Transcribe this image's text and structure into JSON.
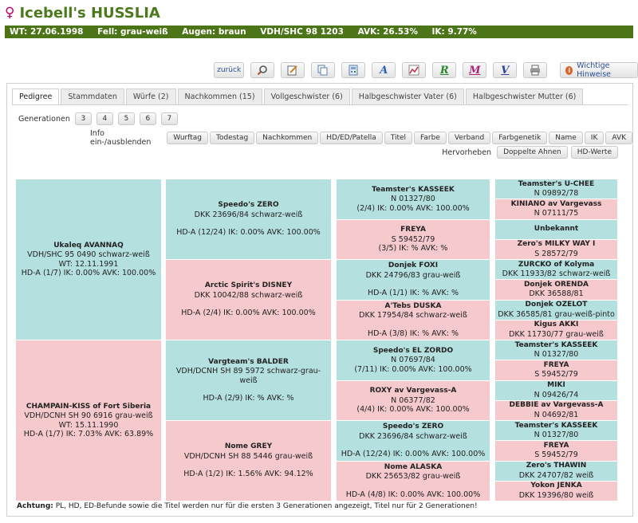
{
  "header": {
    "sex_symbol": "♀",
    "title": "Icebell's HUSSLIA",
    "info": [
      "WT: 27.06.1998",
      "Fell: grau-weiß",
      "Augen: braun",
      "VDH/SHC 98 1203",
      "AVK: 26.53%",
      "IK: 9.77%"
    ]
  },
  "toolbar": {
    "back_label": "zurück",
    "icons": [
      "magnifier-icon",
      "edit-icon",
      "copy-icon",
      "calculator-icon",
      "a-letter-icon",
      "chart-icon",
      "r-letter-icon",
      "m-letter-icon",
      "v-letter-icon",
      "print-icon"
    ],
    "icon_glyphs": [
      "",
      "",
      "",
      "",
      "A",
      "",
      "R",
      "M",
      "V",
      ""
    ],
    "icon_colors": [
      "#333",
      "#333",
      "#333",
      "#333",
      "#2a5fc0",
      "#333",
      "#2a8a2a",
      "#b0207a",
      "#2a3fa0",
      "#333"
    ],
    "hints_label": "Wichtige Hinweise"
  },
  "tabs": [
    "Pedigree",
    "Stammdaten",
    "Würfe (2)",
    "Nachkommen (15)",
    "Vollgeschwister (6)",
    "Halbgeschwister Vater (6)",
    "Halbgeschwister Mutter (6)"
  ],
  "generations": {
    "label": "Generationen",
    "options": [
      "3",
      "4",
      "5",
      "6",
      "7"
    ]
  },
  "info_toggle": {
    "label": "Info ein-/ausblenden",
    "options": [
      "Wurftag",
      "Todestag",
      "Nachkommen",
      "HD/ED/Patella",
      "Titel",
      "Farbe",
      "Verband",
      "Farbgenetik",
      "Name",
      "IK",
      "AVK"
    ]
  },
  "highlight": {
    "label": "Hervorheben",
    "options": [
      "Doppelte Ahnen",
      "HD-Werte"
    ]
  },
  "pedigree": {
    "gen1": [
      {
        "sex": "m",
        "lines": [
          "Ukaleq AVANNAQ",
          "VDH/SHC 95 0490   schwarz-weiß",
          "WT: 12.11.1991",
          "HD-A (1/7) IK: 0.00%  AVK: 100.00%"
        ]
      },
      {
        "sex": "f",
        "lines": [
          "CHAMPAIN-KISS of Fort Siberia",
          "VDH/DCNH SH 90 6916   grau-weiß",
          "WT: 15.11.1990",
          "HD-A (1/7) IK: 7.03%  AVK: 63.89%"
        ]
      }
    ],
    "gen2": [
      {
        "sex": "m",
        "lines": [
          "Speedo's ZERO",
          "DKK 23696/84   schwarz-weiß",
          "",
          "HD-A (12/24) IK: 0.00%  AVK: 100.00%"
        ]
      },
      {
        "sex": "f",
        "lines": [
          "Arctic Spirit's DISNEY",
          "DKK 10042/88   schwarz-weiß",
          "",
          "HD-A (2/4) IK: 0.00%  AVK: 100.00%"
        ]
      },
      {
        "sex": "m",
        "lines": [
          "Vargteam's BALDER",
          "VDH/DCNH SH 89 5972   schwarz-grau-weiß",
          "",
          "HD-A (2/9) IK: %  AVK: %"
        ]
      },
      {
        "sex": "f",
        "lines": [
          "Nome GREY",
          "VDH/DCNH SH 88 5446   grau-weiß",
          "",
          "HD-A (1/2) IK: 1.56%  AVK: 94.12%"
        ]
      }
    ],
    "gen3": [
      {
        "sex": "m",
        "lines": [
          "Teamster's KASSEEK",
          "N  01327/80",
          "(2/4) IK: 0.00%  AVK: 100.00%"
        ]
      },
      {
        "sex": "f",
        "lines": [
          "FREYA",
          "S 59452/79",
          "(3/5) IK: %  AVK: %"
        ]
      },
      {
        "sex": "m",
        "lines": [
          "Donjek FOXI",
          "DKK 24796/83   grau-weiß",
          "",
          "HD-A (1/1) IK: %  AVK: %"
        ]
      },
      {
        "sex": "f",
        "lines": [
          "A'Tebs DUSKA",
          "DKK 17954/84   schwarz-weiß",
          "",
          "HD-A (3/8) IK: %  AVK: %"
        ]
      },
      {
        "sex": "m",
        "lines": [
          "Speedo's EL ZORDO",
          "N  07697/84",
          "(7/11) IK: 0.00%  AVK: 100.00%"
        ]
      },
      {
        "sex": "f",
        "lines": [
          "ROXY av Vargevass-A",
          "N  06377/82",
          "(4/4) IK: 0.00%  AVK: 100.00%"
        ]
      },
      {
        "sex": "m",
        "lines": [
          "Speedo's ZERO",
          "DKK 23696/84   schwarz-weiß",
          "",
          "HD-A (12/24) IK: 0.00%  AVK: 100.00%"
        ]
      },
      {
        "sex": "f",
        "lines": [
          "Nome ALASKA",
          "DKK 25653/82   grau-weiß",
          "",
          "HD-A (4/8) IK: 0.00%  AVK: 100.00%"
        ]
      }
    ],
    "gen4": [
      {
        "sex": "m",
        "lines": [
          "Teamster's U-CHEE",
          "N  09892/78"
        ]
      },
      {
        "sex": "f",
        "lines": [
          "KINIANO av Vargevass",
          "N  07111/75"
        ]
      },
      {
        "sex": "m",
        "lines": [
          "Unbekannt"
        ]
      },
      {
        "sex": "f",
        "lines": [
          "Zero's MILKY WAY I",
          "S 28572/79"
        ]
      },
      {
        "sex": "m",
        "lines": [
          "ZURCKO of Kolyma",
          "DKK 11933/82   schwarz-weiß"
        ]
      },
      {
        "sex": "f",
        "lines": [
          "Donjek ORENDA",
          "DKK 36588/81"
        ]
      },
      {
        "sex": "m",
        "lines": [
          "Donjek OZELOT",
          "DKK 36585/81   grau-weiß-pinto"
        ]
      },
      {
        "sex": "f",
        "lines": [
          "Kigus AKKI",
          "DKK 11730/77   grau-weiß"
        ]
      },
      {
        "sex": "m",
        "lines": [
          "Teamster's KASSEEK",
          "N  01327/80"
        ]
      },
      {
        "sex": "f",
        "lines": [
          "FREYA",
          "S 59452/79"
        ]
      },
      {
        "sex": "m",
        "lines": [
          "MIKI",
          "N  09426/74"
        ]
      },
      {
        "sex": "f",
        "lines": [
          "DEBBIE av Vargevass-A",
          "N  04692/81"
        ]
      },
      {
        "sex": "m",
        "lines": [
          "Teamster's KASSEEK",
          "N  01327/80"
        ]
      },
      {
        "sex": "f",
        "lines": [
          "FREYA",
          "S 59452/79"
        ]
      },
      {
        "sex": "m",
        "lines": [
          "Zero's THAWIN",
          "DKK 24707/82   weiß"
        ]
      },
      {
        "sex": "f",
        "lines": [
          "Yokon JENKA",
          "DKK 19396/80   weiß"
        ]
      }
    ]
  },
  "footnote": {
    "prefix": "Achtung:",
    "text": " PL, HD, ED-Befunde sowie die Titel werden nur für die ersten 3 Generationen angezeigt, Titel nur für 2 Generationen!"
  },
  "colors": {
    "male_bg": "#b5e0e0",
    "female_bg": "#f6c9cc",
    "title_green": "#4a7a1c",
    "infobar_bg": "#4b7516"
  }
}
